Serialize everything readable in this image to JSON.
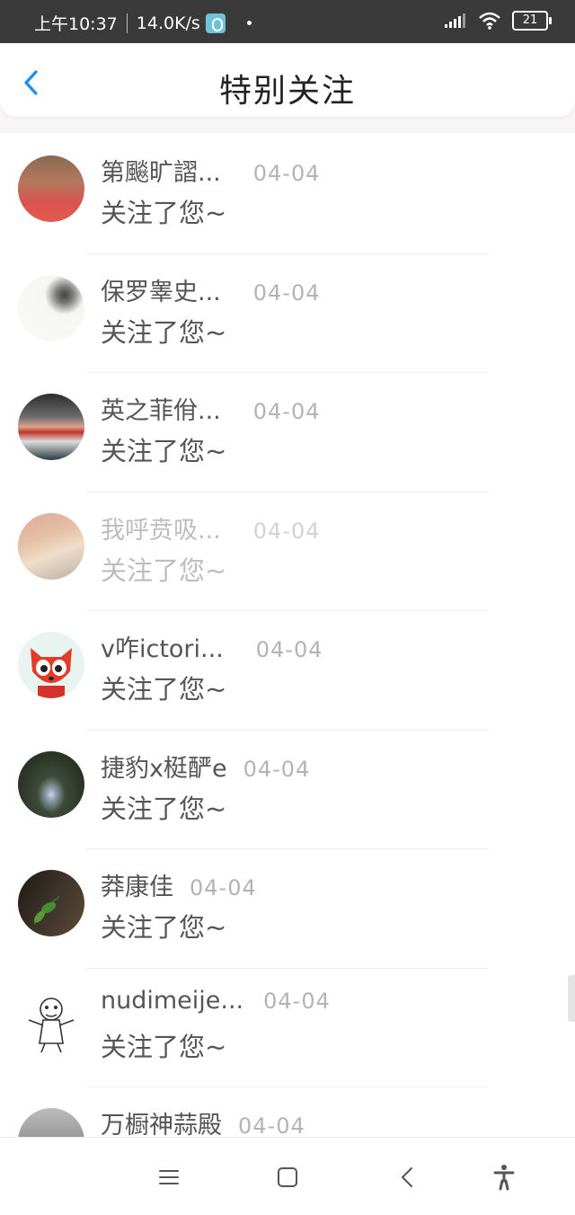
{
  "status_bar": {
    "time": "上午10:37",
    "speed": "14.0K/s",
    "battery": "21"
  },
  "header": {
    "title": "特别关注"
  },
  "list": {
    "items": [
      {
        "name": "第飈旷謵...",
        "date": "04-04",
        "message": "关注了您~",
        "avatar": "autumn-trees-avatar"
      },
      {
        "name": "保罗睾史...",
        "date": "04-04",
        "message": "关注了您~",
        "avatar": "woman-white-avatar"
      },
      {
        "name": "英之菲佾...",
        "date": "04-04",
        "message": "关注了您~",
        "avatar": "girl-apple-avatar"
      },
      {
        "name": "我呼贲吸...",
        "date": "04-04",
        "message": "关注了您~",
        "avatar": "girl-hat-avatar"
      },
      {
        "name": "v咋ictori...",
        "date": "04-04",
        "message": "关注了您~",
        "avatar": "red-fox-cartoon-avatar"
      },
      {
        "name": "捷豹x梃酽e",
        "date": "04-04",
        "message": "关注了您~",
        "avatar": "forest-figure-avatar"
      },
      {
        "name": "莽康佳",
        "date": "04-04",
        "message": "关注了您~",
        "avatar": "green-leaf-avatar"
      },
      {
        "name": "nudimeije...",
        "date": "04-04",
        "message": "关注了您~",
        "avatar": "tiger-sketch-avatar"
      },
      {
        "name": "万橱神蒜殿",
        "date": "04-04",
        "message": "",
        "avatar": "gray-wall-avatar"
      }
    ]
  },
  "colors": {
    "accent": "#1a8cff",
    "status_bar": "#3a3a3a",
    "text": "#555555",
    "date": "#b3b3b3"
  }
}
